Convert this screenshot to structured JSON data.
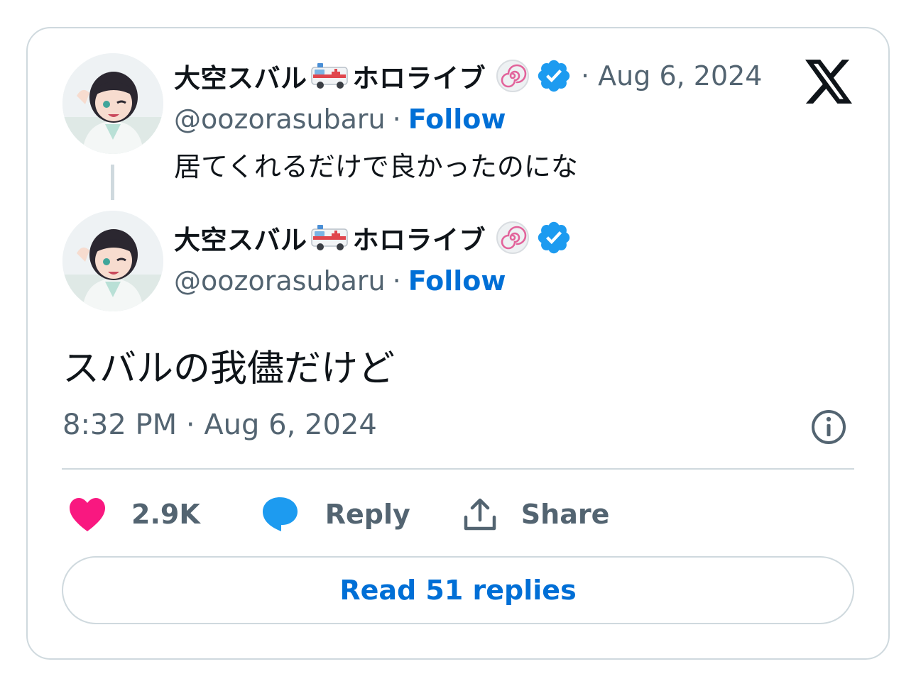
{
  "colors": {
    "text": "#0f1419",
    "muted": "#536471",
    "link": "#006fd6",
    "like": "#f91880",
    "verified": "#1d9bf0",
    "border": "#cfd9de"
  },
  "quoted_tweet": {
    "display_name_part1": "大空スバル",
    "display_name_emoji": "ambulance-emoji",
    "display_name_part2": "ホロライブ",
    "affiliate_badge": "hololive-swirl-icon",
    "verified_badge": "verified-check-icon",
    "date": "· Aug 6, 2024",
    "handle": "@oozorasubaru",
    "separator": "·",
    "follow_label": "Follow",
    "text": "居てくれるだけで良かったのにな"
  },
  "main_tweet": {
    "display_name_part1": "大空スバル",
    "display_name_emoji": "ambulance-emoji",
    "display_name_part2": "ホロライブ",
    "affiliate_badge": "hololive-swirl-icon",
    "verified_badge": "verified-check-icon",
    "handle": "@oozorasubaru",
    "separator": "·",
    "follow_label": "Follow",
    "text": "スバルの我儘だけど",
    "timestamp": "8:32 PM · Aug 6, 2024"
  },
  "actions": {
    "like_icon": "heart-icon",
    "like_count": "2.9K",
    "reply_icon": "speech-bubble-icon",
    "reply_label": "Reply",
    "share_icon": "share-upload-icon",
    "share_label": "Share"
  },
  "read_replies_label": "Read 51 replies",
  "brand_icon": "x-logo-icon",
  "info_icon": "info-icon"
}
